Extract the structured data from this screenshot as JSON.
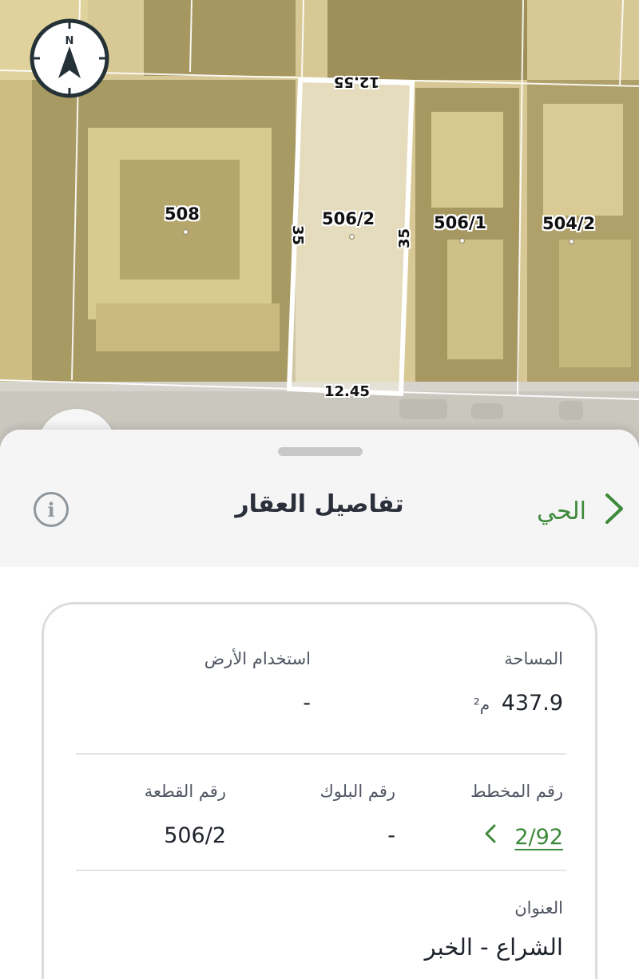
{
  "map": {
    "parcels": [
      {
        "id": "508",
        "label": "508"
      },
      {
        "id": "506_2",
        "label": "506/2"
      },
      {
        "id": "506_1",
        "label": "506/1"
      },
      {
        "id": "504_2",
        "label": "504/2"
      }
    ],
    "dimensions": {
      "top": "12.55",
      "bottom": "12.45",
      "left": "35",
      "right": "35"
    },
    "compass": {
      "north_label": "N"
    },
    "highlight_color": "#ffffff"
  },
  "sheet": {
    "title": "تفاصيل العقار",
    "back_link_label": "الحي",
    "info_icon": "info-icon",
    "accent_color": "#3d8a3a"
  },
  "details": {
    "area": {
      "label": "المساحة",
      "value": "437.9",
      "unit": "م²"
    },
    "land_use": {
      "label": "استخدام الأرض",
      "value": "-"
    },
    "plan_number": {
      "label": "رقم المخطط",
      "value": "2/92"
    },
    "block_number": {
      "label": "رقم البلوك",
      "value": "-"
    },
    "parcel_number": {
      "label": "رقم القطعة",
      "value": "506/2"
    },
    "address": {
      "label": "العنوان",
      "value": "الشراع - الخبر"
    }
  }
}
